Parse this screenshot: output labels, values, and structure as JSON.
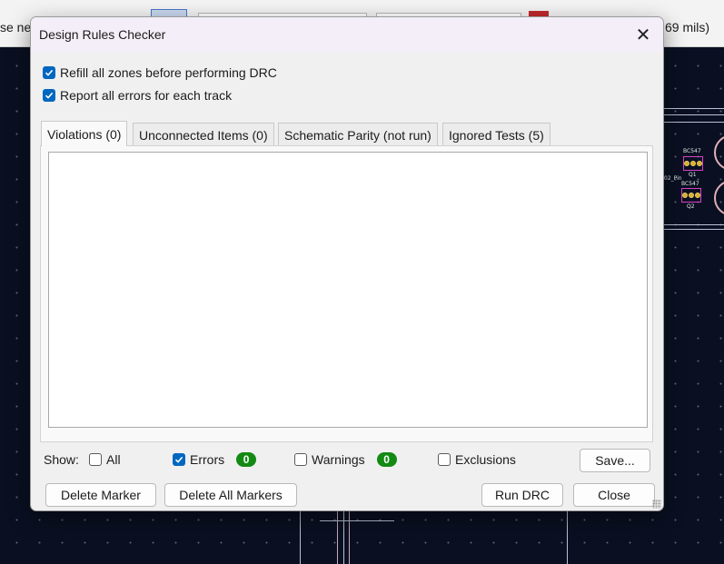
{
  "background": {
    "toolbar_left_text": "se ne",
    "toolbar_right_text": "69 mils)",
    "parts": [
      {
        "label": "BC547",
        "ref": "Q1"
      },
      {
        "label": "BC547",
        "ref": "Q2"
      }
    ],
    "net_label": "02_Pin"
  },
  "dialog": {
    "title": "Design Rules Checker",
    "close_icon": "close-icon",
    "options": {
      "refill_zones": {
        "label": "Refill all zones before performing DRC",
        "checked": true
      },
      "report_all_errors": {
        "label": "Report all errors for each track",
        "checked": true
      }
    },
    "tabs": [
      {
        "label": "Violations (0)",
        "active": true
      },
      {
        "label": "Unconnected Items (0)",
        "active": false
      },
      {
        "label": "Schematic Parity (not run)",
        "active": false
      },
      {
        "label": "Ignored Tests (5)",
        "active": false
      }
    ],
    "show": {
      "label": "Show:",
      "all": {
        "label": "All",
        "checked": false
      },
      "errors": {
        "label": "Errors",
        "checked": true,
        "count": "0"
      },
      "warnings": {
        "label": "Warnings",
        "checked": false,
        "count": "0"
      },
      "exclusions": {
        "label": "Exclusions",
        "checked": false
      }
    },
    "buttons": {
      "save": "Save...",
      "delete_marker": "Delete Marker",
      "delete_all_markers": "Delete All Markers",
      "run_drc": "Run DRC",
      "close": "Close"
    },
    "colors": {
      "accent": "#0067c0",
      "badge": "#138a13"
    }
  }
}
